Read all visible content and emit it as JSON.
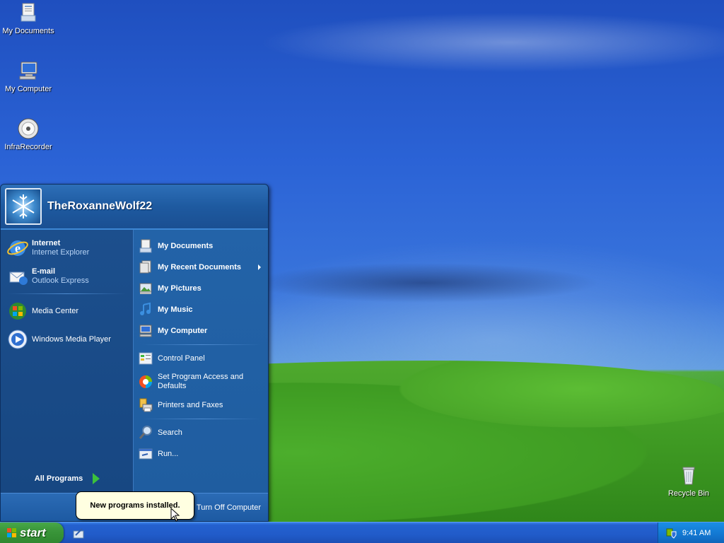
{
  "desktop": {
    "icons": [
      {
        "label": "My Documents"
      },
      {
        "label": "My Computer"
      },
      {
        "label": "InfraRecorder"
      },
      {
        "label": "Recycle Bin"
      }
    ]
  },
  "start_menu": {
    "username": "TheRoxanneWolf22",
    "pinned": [
      {
        "title": "Internet",
        "subtitle": "Internet Explorer"
      },
      {
        "title": "E-mail",
        "subtitle": "Outlook Express"
      }
    ],
    "recent": [
      {
        "label": "Media Center"
      },
      {
        "label": "Windows Media Player"
      }
    ],
    "all_programs": "All Programs",
    "places": [
      {
        "label": "My Documents"
      },
      {
        "label": "My Recent Documents"
      },
      {
        "label": "My Pictures"
      },
      {
        "label": "My Music"
      },
      {
        "label": "My Computer"
      }
    ],
    "settings": [
      {
        "label": "Control Panel"
      },
      {
        "label": "Set Program Access and Defaults"
      },
      {
        "label": "Printers and Faxes"
      }
    ],
    "tools": [
      {
        "label": "Search"
      },
      {
        "label": "Run..."
      }
    ],
    "turn_off": "Turn Off Computer"
  },
  "balloon": {
    "text": "New programs installed."
  },
  "taskbar": {
    "start_label": "start",
    "clock": "9:41 AM"
  },
  "colors": {
    "start_green": "#3a963a",
    "taskbar_blue": "#215bc9",
    "tray_blue": "#1276d0",
    "menu_blue": "#1f5da0"
  }
}
